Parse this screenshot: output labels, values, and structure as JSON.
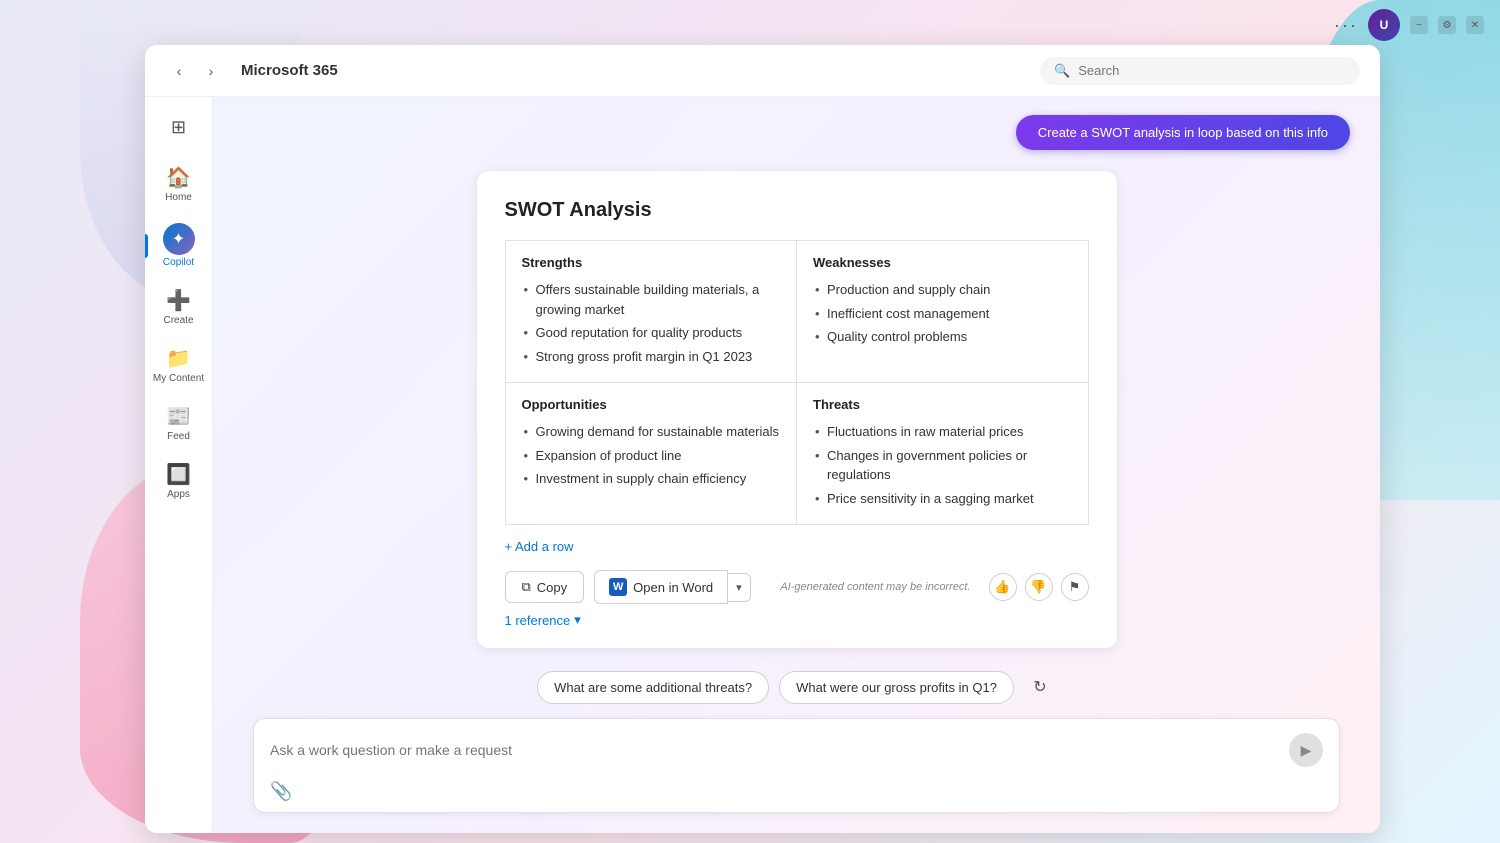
{
  "topbar": {
    "dots": "···",
    "avatar_initials": "U",
    "minimize": "−",
    "settings": "⚙",
    "close": "✕"
  },
  "window": {
    "title": "Microsoft 365",
    "search_placeholder": "Search"
  },
  "sidebar": {
    "grid_icon": "⊞",
    "items": [
      {
        "id": "home",
        "label": "Home",
        "icon": "🏠",
        "active": false
      },
      {
        "id": "copilot",
        "label": "Copilot",
        "icon": "✦",
        "active": true
      },
      {
        "id": "create",
        "label": "Create",
        "icon": "➕",
        "active": false
      },
      {
        "id": "my-content",
        "label": "My Content",
        "icon": "📁",
        "active": false
      },
      {
        "id": "feed",
        "label": "Feed",
        "icon": "📰",
        "active": false
      },
      {
        "id": "apps",
        "label": "Apps",
        "icon": "🔲",
        "active": false
      }
    ]
  },
  "copilot_prompt_btn": "Create a SWOT analysis in loop based on this info",
  "swot": {
    "title": "SWOT Analysis",
    "strengths": {
      "label": "Strengths",
      "items": [
        "Offers sustainable building materials, a growing market",
        "Good reputation for quality products",
        "Strong gross profit margin in Q1 2023"
      ]
    },
    "weaknesses": {
      "label": "Weaknesses",
      "items": [
        "Production and supply chain",
        "Inefficient cost management",
        "Quality control problems"
      ]
    },
    "opportunities": {
      "label": "Opportunities",
      "items": [
        "Growing demand for sustainable materials",
        "Expansion of product line",
        "Investment in supply chain efficiency"
      ]
    },
    "threats": {
      "label": "Threats",
      "items": [
        "Fluctuations in raw material prices",
        "Changes in government policies or regulations",
        "Price sensitivity in a sagging market"
      ]
    },
    "add_row_label": "+ Add a row"
  },
  "actions": {
    "copy_label": "Copy",
    "open_word_label": "Open in Word",
    "ai_disclaimer": "AI-generated content may be incorrect."
  },
  "reference": {
    "label": "1 reference",
    "chevron": "▾"
  },
  "suggestions": {
    "chips": [
      "What are some additional threats?",
      "What were our gross profits in Q1?"
    ]
  },
  "input": {
    "placeholder": "Ask a work question or make a request"
  },
  "icons": {
    "back_arrow": "‹",
    "forward_arrow": "›",
    "search": "🔍",
    "copy": "⧉",
    "word_letter": "W",
    "chevron_down": "▾",
    "thumbs_up": "👍",
    "thumbs_down": "👎",
    "flag": "⚑",
    "refresh": "↻",
    "paperclip": "📎",
    "send": "▶",
    "add": "+"
  }
}
